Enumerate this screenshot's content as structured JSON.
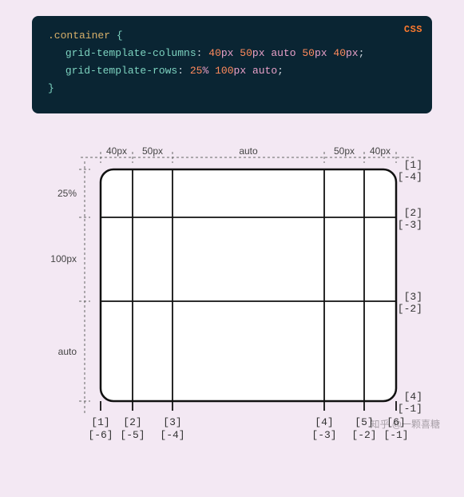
{
  "code": {
    "language": "CSS",
    "selector": ".container",
    "brace_open": "{",
    "brace_close": "}",
    "prop_cols": "grid-template-columns",
    "colon1": ":",
    "cols_v1": "40",
    "cols_u1": "px",
    "cols_v2": "50",
    "cols_u2": "px",
    "cols_v3": "auto",
    "cols_v4": "50",
    "cols_u4": "px",
    "cols_v5": "40",
    "cols_u5": "px",
    "semi1": ";",
    "prop_rows": "grid-template-rows",
    "colon2": ":",
    "rows_v1": "25",
    "rows_u1": "%",
    "rows_v2": "100",
    "rows_u2": "px",
    "rows_v3": "auto",
    "semi2": ";"
  },
  "diagram": {
    "top_labels": {
      "c1": "40px",
      "c2": "50px",
      "c3": "auto",
      "c4": "50px",
      "c5": "40px"
    },
    "left_labels": {
      "r1": "25%",
      "r2": "100px",
      "r3": "auto"
    },
    "right_indices": {
      "l1p": "[1]",
      "l1n": "[-4]",
      "l2p": "[2]",
      "l2n": "[-3]",
      "l3p": "[3]",
      "l3n": "[-2]",
      "l4p": "[4]",
      "l4n": "[-1]"
    },
    "bottom_indices": {
      "c1p": "[1]",
      "c1n": "[-6]",
      "c2p": "[2]",
      "c2n": "[-5]",
      "c3p": "[3]",
      "c3n": "[-4]",
      "c4p": "[4]",
      "c4n": "[-3]",
      "c5p": "[5]",
      "c5n": "[-2]",
      "c6p": "[6]",
      "c6n": "[-1]"
    }
  },
  "watermark": "知乎 @一颗喜糖"
}
